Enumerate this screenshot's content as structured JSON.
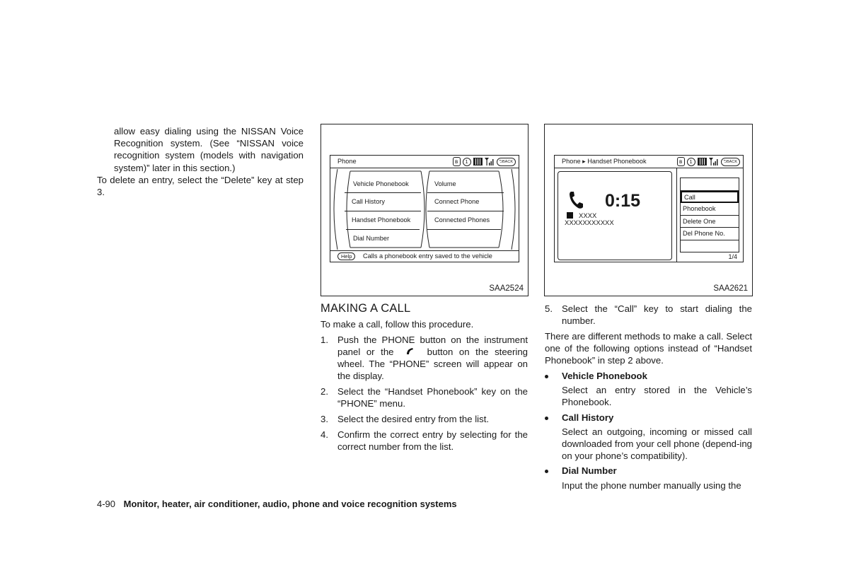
{
  "left_column": {
    "continued_paragraph": "allow easy dialing using the NISSAN Voice Recognition system. (See “NISSAN voice recognition system (models with navigation system)” later in this section.)",
    "delete_note": "To delete an entry, select the “Delete” key at step 3."
  },
  "figure1": {
    "code": "SAA2524",
    "screen_title": "Phone",
    "status_icons": [
      "bluetooth-icon",
      "phone-slot-1-icon",
      "battery-icon",
      "signal-strength-icon",
      "back-button-icon"
    ],
    "back_label": "BACK",
    "menu_left": [
      "Vehicle Phonebook",
      "Call History",
      "Handset Phonebook",
      "Dial Number"
    ],
    "menu_right": [
      "Volume",
      "Connect Phone",
      "Connected Phones",
      ""
    ],
    "help_label": "Help",
    "help_text": "Calls a phonebook entry saved to the vehicle"
  },
  "figure2": {
    "code": "SAA2621",
    "screen_title": "Phone ▸ Handset Phonebook",
    "back_label": "BACK",
    "call_timer": "0:15",
    "contact_name": "XXXX",
    "contact_number": "XXXXXXXXXXX",
    "list_items": [
      "",
      "Call",
      "Phonebook",
      "Delete One",
      "Del Phone No.",
      ""
    ],
    "selected_item": "Call",
    "page_indicator": "1/4"
  },
  "middle_column": {
    "section_title": "MAKING A CALL",
    "intro": "To make a call, follow this procedure.",
    "steps": [
      {
        "num": "1.",
        "text_before_icon": "Push the PHONE button on the instrument panel or the ",
        "icon": "phone-handset-icon",
        "text_after_icon": " button on the steering wheel. The “PHONE” screen will appear on the display."
      },
      {
        "num": "2.",
        "text": "Select the “Handset Phonebook” key on the “PHONE” menu."
      },
      {
        "num": "3.",
        "text": "Select the desired entry from the list."
      },
      {
        "num": "4.",
        "text": "Confirm the correct entry by selecting for the correct number from the list."
      }
    ]
  },
  "right_column": {
    "step5": {
      "num": "5.",
      "text": "Select the “Call” key to start dialing the number."
    },
    "methods_intro": "There are different methods to make a call. Select one of the following options instead of “Handset Phonebook” in step 2 above.",
    "options": [
      {
        "title": "Vehicle Phonebook",
        "desc": "Select an entry stored in the Vehicle’s Phonebook."
      },
      {
        "title": "Call History",
        "desc": "Select an outgoing, incoming or missed call downloaded from your cell phone (depend-ing on your phone’s compatibility)."
      },
      {
        "title": "Dial Number",
        "desc": "Input the phone number manually using the"
      }
    ]
  },
  "footer": {
    "page_number": "4-90",
    "chapter_title": "Monitor, heater, air conditioner, audio, phone and voice recognition systems"
  }
}
